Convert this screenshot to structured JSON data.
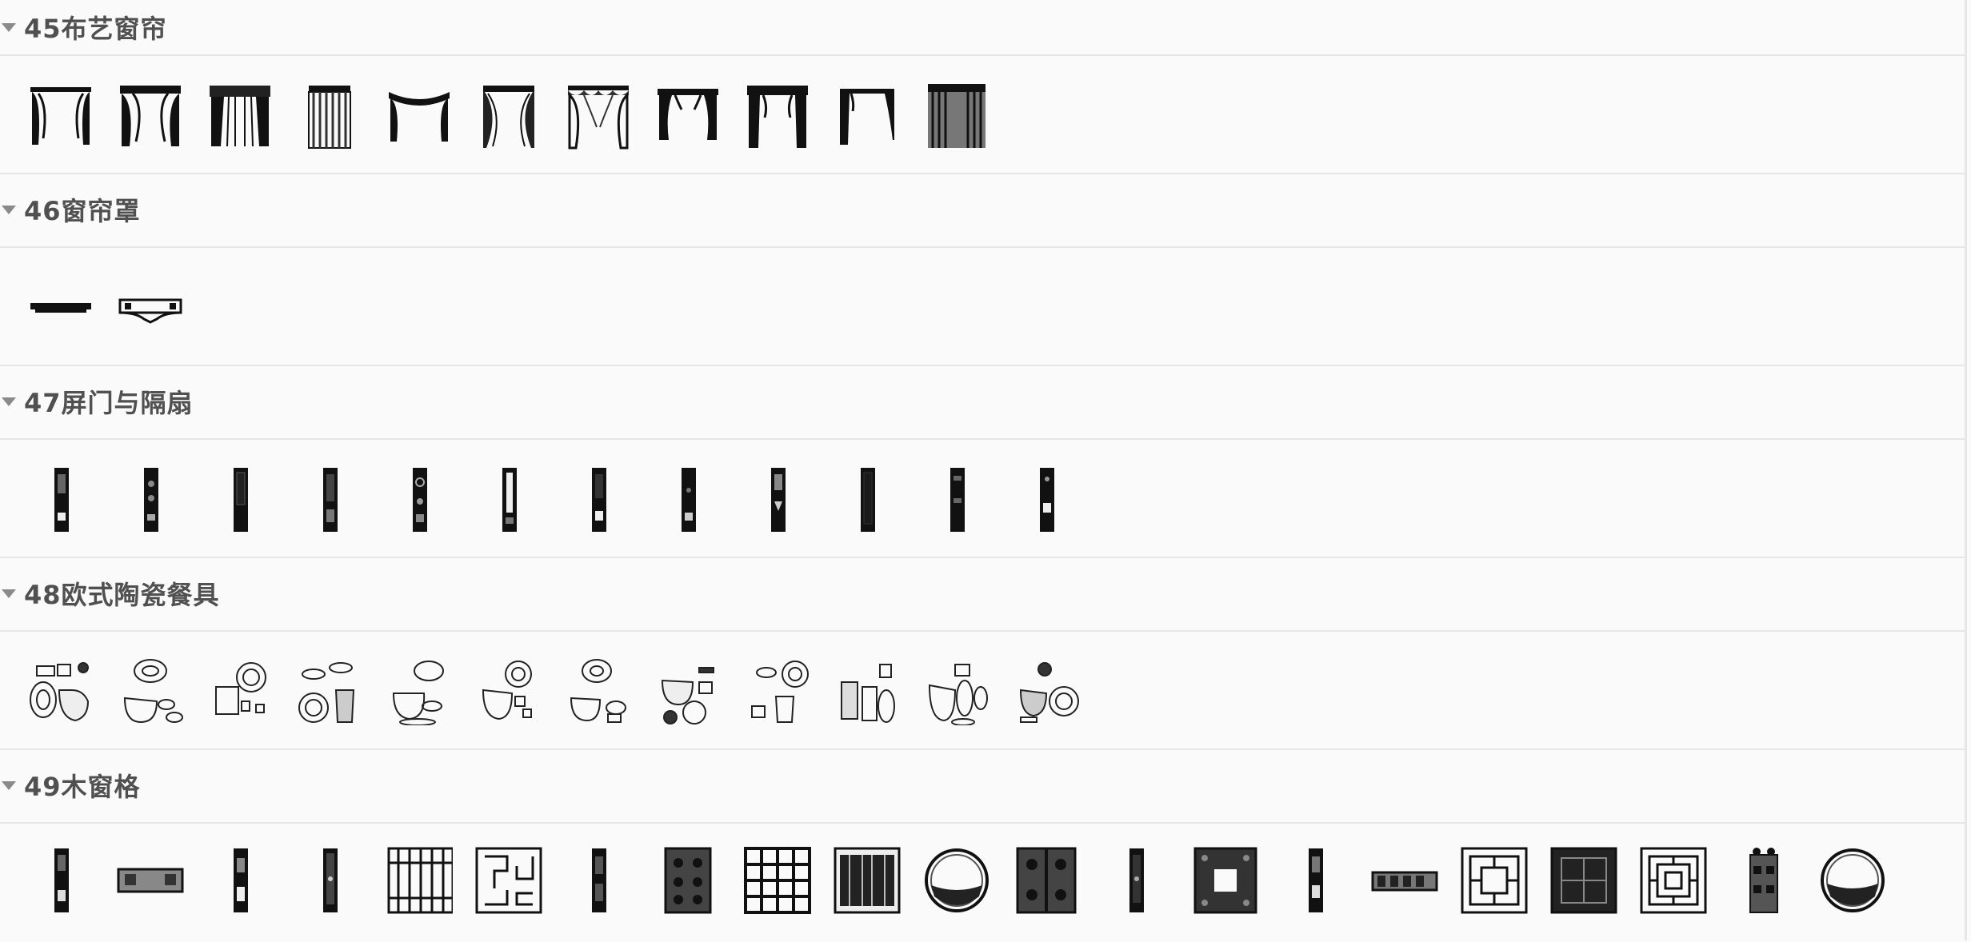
{
  "sections": [
    {
      "title": "45布艺窗帘",
      "icon": "curtain-icon",
      "count": 11
    },
    {
      "title": "46窗帘罩",
      "icon": "valance-icon",
      "count": 2
    },
    {
      "title": "47屏门与隔扇",
      "icon": "screen-door-icon",
      "count": 12
    },
    {
      "title": "48欧式陶瓷餐具",
      "icon": "tableware-icon",
      "count": 12
    },
    {
      "title": "49木窗格",
      "icon": "wood-lattice-icon",
      "count": 21
    }
  ],
  "colors": {
    "background": "#fafafa",
    "divider": "#e6e6e6",
    "header_text": "#505050",
    "caret": "#8a8a8a"
  }
}
